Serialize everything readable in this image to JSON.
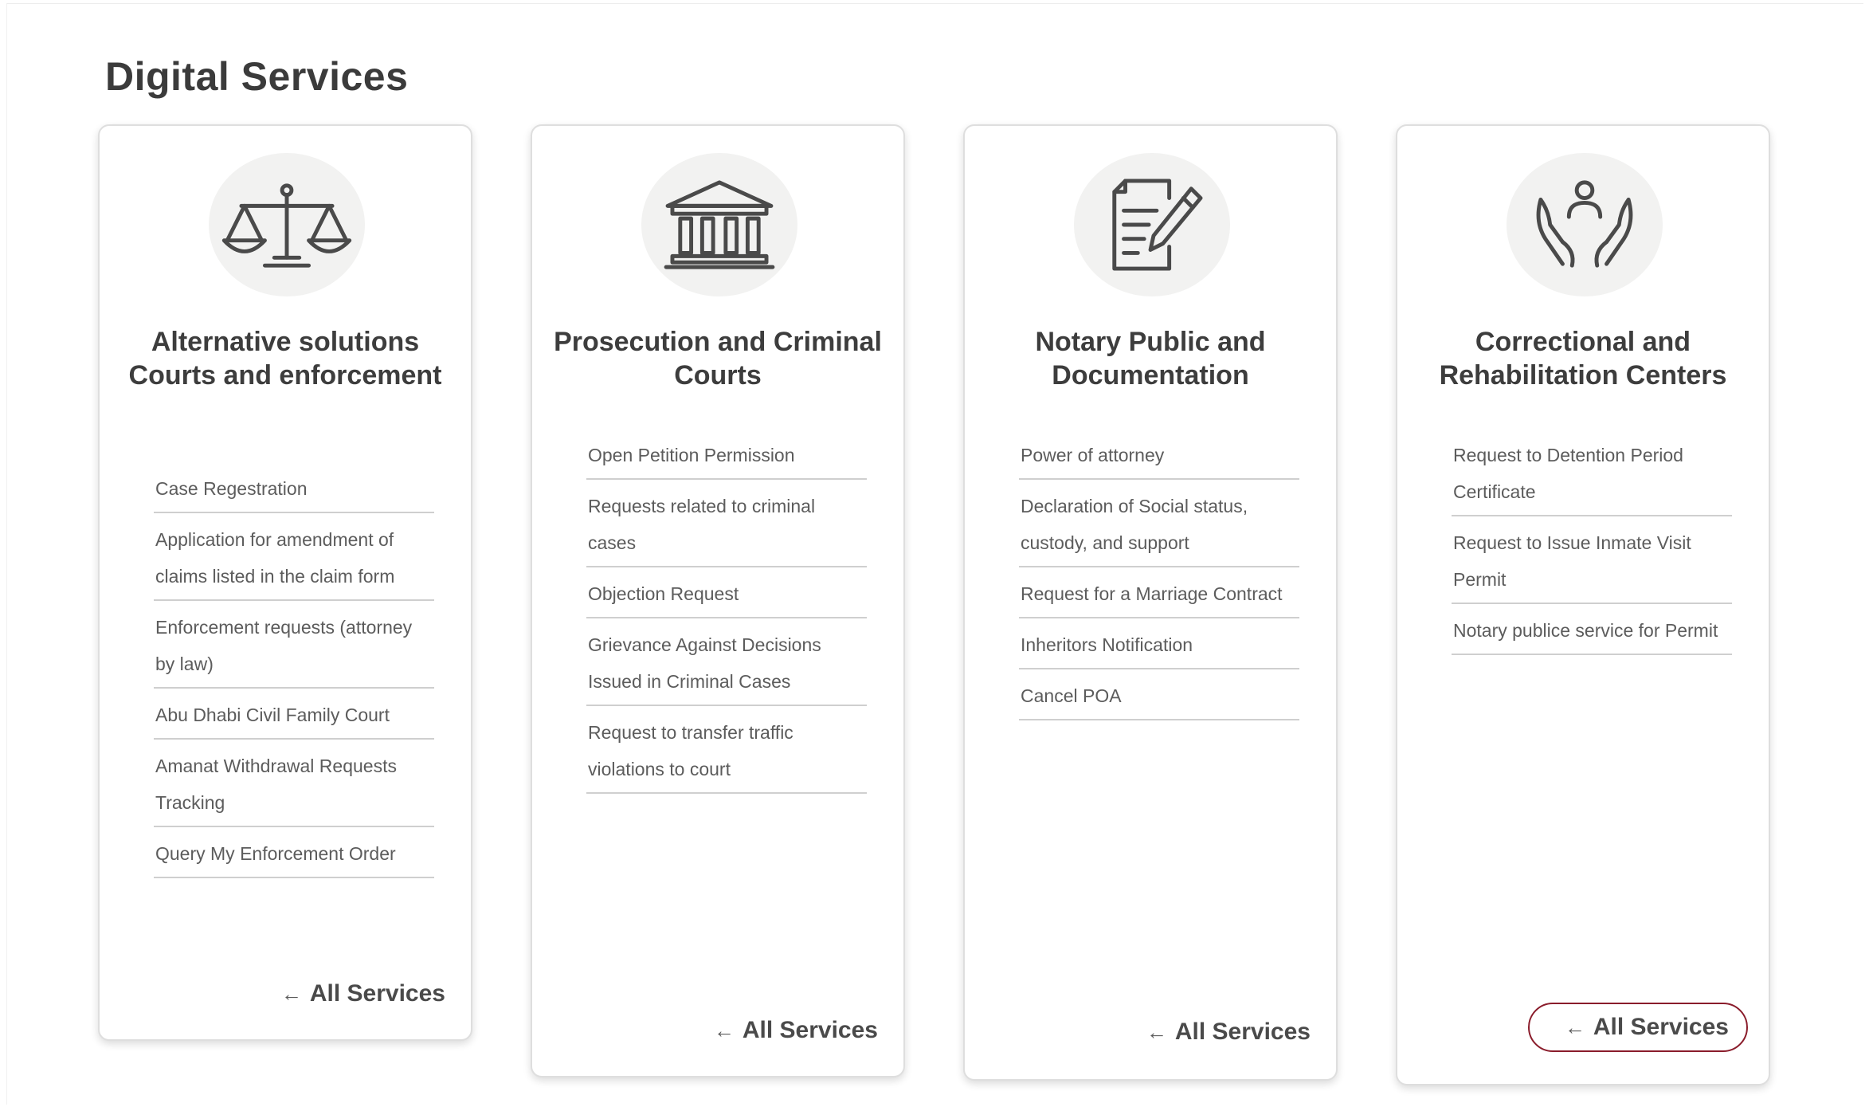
{
  "page": {
    "title": "Digital Services"
  },
  "cards": [
    {
      "title": "Alternative solutions Courts and enforcement",
      "icon": "scales-of-justice-icon",
      "services": [
        "Case Regestration",
        "Application for amendment of claims listed in the claim form",
        "Enforcement requests (attorney by law)",
        "Abu Dhabi Civil Family Court",
        "Amanat Withdrawal Requests Tracking",
        "Query My Enforcement Order"
      ],
      "all_services": {
        "arrow": "←",
        "label": "All Services"
      }
    },
    {
      "title": "Prosecution and Criminal Courts",
      "icon": "courthouse-icon",
      "services": [
        "Open Petition Permission",
        "Requests related to criminal cases",
        "Objection Request",
        "Grievance Against Decisions Issued in Criminal Cases",
        "Request to transfer traffic violations to court"
      ],
      "all_services": {
        "arrow": "←",
        "label": "All Services"
      }
    },
    {
      "title": "Notary Public and Documentation",
      "icon": "document-pen-icon",
      "services": [
        "Power of attorney",
        "Declaration of Social status, custody, and support",
        "Request for a Marriage Contract",
        "Inheritors Notification",
        "Cancel POA"
      ],
      "all_services": {
        "arrow": "←",
        "label": "All Services"
      }
    },
    {
      "title": "Correctional and Rehabilitation Centers",
      "icon": "hands-care-icon",
      "services": [
        "Request to Detention Period Certificate",
        "Request to Issue Inmate Visit Permit",
        "Notary publice service for Permit"
      ],
      "all_services": {
        "arrow": "←",
        "label": "All Services"
      }
    }
  ],
  "colors": {
    "accent": "#8a1c2b",
    "icon_bg": "#f2f2f1",
    "text": "#3d3d3d"
  }
}
